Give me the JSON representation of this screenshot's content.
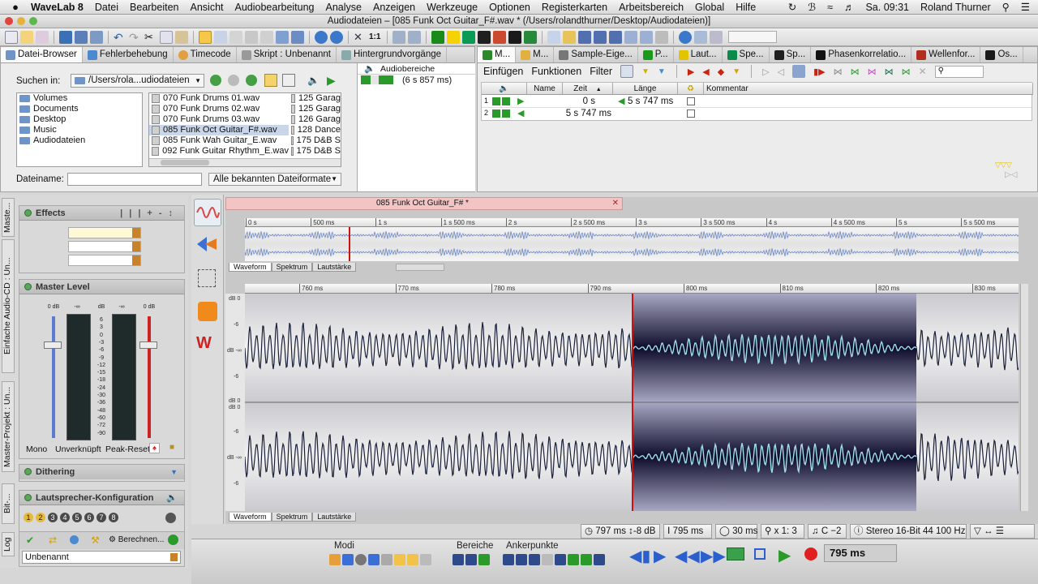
{
  "menubar": {
    "apple": "",
    "app": "WaveLab 8",
    "items": [
      "Datei",
      "Bearbeiten",
      "Ansicht",
      "Audiobearbeitung",
      "Analyse",
      "Anzeigen",
      "Werkzeuge",
      "Optionen",
      "Registerkarten",
      "Arbeitsbereich",
      "Global",
      "Hilfe"
    ],
    "clock": "Sa. 09:31",
    "user": "Roland Thurner"
  },
  "window": {
    "title": "Audiodateien – [085 Funk Oct Guitar_F#.wav * (/Users/rolandthurner/Desktop/Audiodateien)]"
  },
  "browser": {
    "tabs": [
      "Datei-Browser",
      "Fehlerbehebung",
      "Timecode",
      "Skript : Unbenannt",
      "Hintergrundvorgänge"
    ],
    "search_label": "Suchen in:",
    "path": "/Users/rola...udiodateien",
    "folders": [
      "Volumes",
      "Documents",
      "Desktop",
      "Music",
      "Audiodateien"
    ],
    "files": [
      "070 Funk Drums 01.wav",
      "070 Funk Drums 02.wav",
      "070 Funk Drums 03.wav",
      "085 Funk Oct Guitar_F#.wav",
      "085 Funk Wah Guitar_E.wav",
      "092 Funk Guitar Rhythm_E.wav"
    ],
    "files2": [
      "125 Garag",
      "125 Garag",
      "126 Garag",
      "128 Dance",
      "175 D&B S",
      "175 D&B S"
    ],
    "selected_file": "085 Funk Oct Guitar_F#.wav",
    "filename_label": "Dateiname:",
    "filename_value": "",
    "format": "Alle bekannten Dateiformate",
    "regions_header": "Audiobereiche",
    "regions_value": "(6 s 857 ms)"
  },
  "markers": {
    "tabs": [
      "M...",
      "M...",
      "Sample-Eige...",
      "P...",
      "Laut...",
      "Spe...",
      "Sp...",
      "Phasenkorrelatio...",
      "Wellenfor...",
      "Os..."
    ],
    "menu": [
      "Einfügen",
      "Funktionen",
      "Filter"
    ],
    "columns": [
      "Name",
      "Zeit",
      "Länge",
      "Kommentar"
    ],
    "rows": [
      {
        "num": "1",
        "name": "",
        "time": "0 s",
        "length": "5 s 747 ms",
        "comment": ""
      },
      {
        "num": "2",
        "name": "",
        "time": "5 s 747 ms",
        "length": "",
        "comment": ""
      }
    ]
  },
  "effects": {
    "title": "Effects",
    "slots": [
      "",
      "",
      ""
    ]
  },
  "master": {
    "title": "Master Level",
    "top_labels": [
      "0 dB",
      "-∞",
      "dB",
      "-∞",
      "0 dB"
    ],
    "scale": [
      "6",
      "3",
      "0",
      "-3",
      "-6",
      "-9",
      "-12",
      "-15",
      "-18",
      "-24",
      "-30",
      "-36",
      "-48",
      "-60",
      "-72",
      "-90"
    ],
    "mono": "Mono",
    "unlinked": "Unverknüpft",
    "peak_reset": "Peak-Reset"
  },
  "dithering": {
    "title": "Dithering"
  },
  "speaker": {
    "title": "Lautsprecher-Konfiguration",
    "numbers": [
      "1",
      "2",
      "3",
      "4",
      "5",
      "6",
      "7",
      "8"
    ],
    "compute": "Berechnen..."
  },
  "preset": {
    "name": "Unbenannt"
  },
  "vtabs": [
    "Maste...",
    "Einfache Audio-CD : Un...",
    "Master-Projekt : Un...",
    "Bit-...",
    "Log"
  ],
  "wave": {
    "tab_title": "085 Funk Oct Guitar_F# *",
    "overview_ticks": [
      "0 s",
      "500 ms",
      "1 s",
      "1 s 500 ms",
      "2 s",
      "2 s 500 ms",
      "3 s",
      "3 s 500 ms",
      "4 s",
      "4 s 500 ms",
      "5 s",
      "5 s 500 ms"
    ],
    "main_ticks": [
      "760 ms",
      "770 ms",
      "780 ms",
      "790 ms",
      "800 ms",
      "810 ms",
      "820 ms",
      "830 ms"
    ],
    "view_tabs": [
      "Waveform",
      "Spektrum",
      "Lautstärke"
    ],
    "db_labels": [
      "dB 0",
      "-6",
      "dB -∞",
      "-6",
      "dB 0",
      "dB 0",
      "-6",
      "dB -∞",
      "-6"
    ]
  },
  "status": {
    "cursor": "797 ms ↕-8 dB",
    "position": "795 ms",
    "length": "30 ms",
    "zoom": "x 1: 3",
    "pitch": "C −2",
    "format": "Stereo 16-Bit 44 100 Hz"
  },
  "transport": {
    "modi": "Modi",
    "bereiche": "Bereiche",
    "ankerpunkte": "Ankerpunkte",
    "time": "795 ms"
  },
  "colors": {
    "selection": "#4a4b72",
    "wave": "#1a2038",
    "wave_selected": "#9fdde8",
    "cursor": "#cc1111",
    "tabpink": "#f3c4c4"
  }
}
